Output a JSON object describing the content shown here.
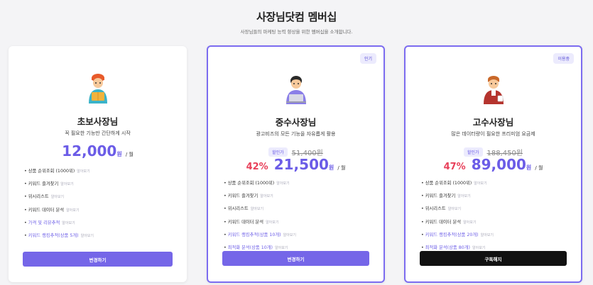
{
  "header": {
    "title": "사장님닷컴 멤버십",
    "subtitle": "사장님들의 마케팅 능력 향상을 위한 멤버십을 소개합니다."
  },
  "colors": {
    "accent": "#7566e8",
    "discount": "#e8405a",
    "dark_button": "#111111"
  },
  "plans": [
    {
      "name": "초보사장님",
      "description": "꼭 필요한 기능만 간단하게 시작",
      "price": "12,000",
      "currency": "원",
      "per": "/ 월",
      "badge": "",
      "features": [
        {
          "bullet": "•",
          "text": "상품 순위조회 (1000위)",
          "more": "알아보기",
          "accent": false
        },
        {
          "bullet": "•",
          "text": "키워드 즐겨찾기",
          "more": "알아보기",
          "accent": false
        },
        {
          "bullet": "•",
          "text": "위시리스트",
          "more": "알아보기",
          "accent": false
        },
        {
          "bullet": "•",
          "text": "키워드 데이터 분석",
          "more": "알아보기",
          "accent": false
        },
        {
          "bullet": "•",
          "text": "가격 및 리뷰추적",
          "more": "알아보기",
          "accent": true
        },
        {
          "bullet": "•",
          "text": "키워드 랭킹추적(상품 5개)",
          "more": "알아보기",
          "accent": true
        }
      ],
      "cta": "변경하기"
    },
    {
      "name": "중수사장님",
      "description": "광고비즈의 모든 기능을 자유롭게 활용",
      "badge": "인기",
      "discount_chip": "할인가",
      "original_price": "51,400원",
      "discount_pct": "42%",
      "price": "21,500",
      "currency": "원",
      "per": "/ 월",
      "features": [
        {
          "bullet": "•",
          "text": "상품 순위조회 (1000위)",
          "more": "알아보기",
          "accent": false
        },
        {
          "bullet": "•",
          "text": "키워드 즐겨찾기",
          "more": "알아보기",
          "accent": false
        },
        {
          "bullet": "•",
          "text": "위시리스트",
          "more": "알아보기",
          "accent": false
        },
        {
          "bullet": "•",
          "text": "키워드 데이터 분석",
          "more": "알아보기",
          "accent": false
        },
        {
          "bullet": "•",
          "text": "키워드 랭킹추적(상품 10개)",
          "more": "알아보기",
          "accent": true
        },
        {
          "bullet": "•",
          "text": "최적화 분석(상품 10개)",
          "more": "알아보기",
          "accent": true
        }
      ],
      "cta": "변경하기"
    },
    {
      "name": "고수사장님",
      "description": "많은 데이터량이 필요한 프리미엄 요금제",
      "badge": "이용중",
      "discount_chip": "할인가",
      "original_price": "188,450원",
      "discount_pct": "47%",
      "price": "89,000",
      "currency": "원",
      "per": "/ 월",
      "features": [
        {
          "bullet": "•",
          "text": "상품 순위조회 (1000위)",
          "more": "알아보기",
          "accent": false
        },
        {
          "bullet": "•",
          "text": "키워드 즐겨찾기",
          "more": "알아보기",
          "accent": false
        },
        {
          "bullet": "•",
          "text": "위시리스트",
          "more": "알아보기",
          "accent": false
        },
        {
          "bullet": "•",
          "text": "키워드 데이터 분석",
          "more": "알아보기",
          "accent": false
        },
        {
          "bullet": "•",
          "text": "키워드 랭킹추적(상품 20개)",
          "more": "알아보기",
          "accent": true
        },
        {
          "bullet": "•",
          "text": "최적화 분석(상품 80개)",
          "more": "알아보기",
          "accent": true
        }
      ],
      "cta": "구독해지"
    }
  ]
}
